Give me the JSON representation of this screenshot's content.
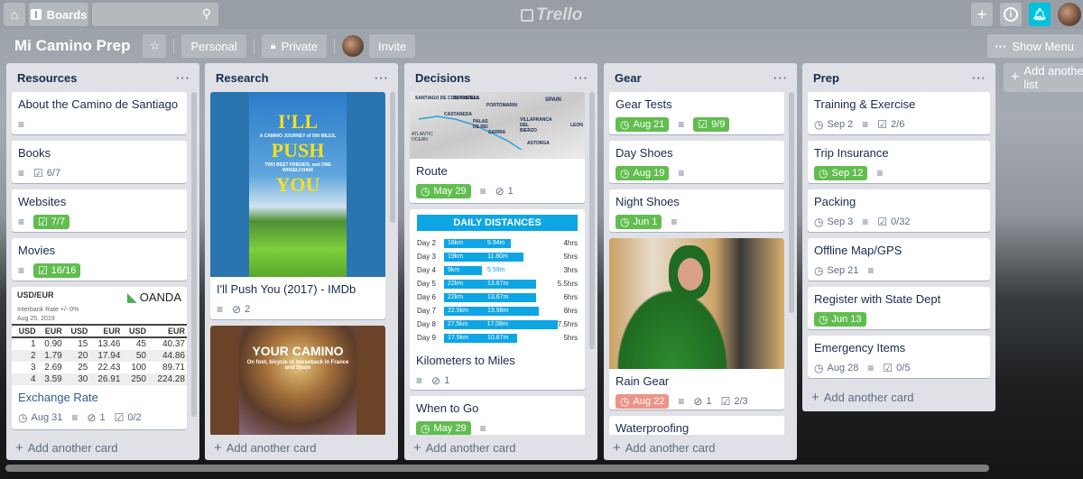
{
  "topbar": {
    "boards_label": "Boards",
    "search_placeholder": "",
    "logo_text": "Trello"
  },
  "board": {
    "title": "Mi Camino Prep",
    "team_label": "Personal",
    "visibility_label": "Private",
    "invite_label": "Invite",
    "show_menu_label": "Show Menu",
    "add_list_label": "Add another list"
  },
  "add_card_label": "Add another card",
  "lists": [
    {
      "title": "Resources",
      "cards": [
        {
          "title": "About the Camino de Santiago",
          "description": true
        },
        {
          "title": "Books",
          "description": true,
          "checklist": "6/7",
          "checklist_complete": false
        },
        {
          "title": "Websites",
          "description": true,
          "checklist": "7/7",
          "checklist_complete": true
        },
        {
          "title": "Movies",
          "description": true,
          "checklist": "16/16",
          "checklist_complete": true
        },
        {
          "title": "Exchange Rate",
          "due": "Aug 31",
          "description": true,
          "attachments": "1",
          "checklist": "0/2",
          "cover": {
            "pair": "USD/EUR",
            "brand": "OANDA",
            "subtitle": "Interbank Rate +/- 0%",
            "date": "Aug 25, 2019",
            "headers": [
              "USD",
              "EUR",
              "USD",
              "EUR",
              "USD",
              "EUR"
            ],
            "rows": [
              [
                "1",
                "0.90",
                "15",
                "13.46",
                "45",
                "40.37"
              ],
              [
                "2",
                "1.79",
                "20",
                "17.94",
                "50",
                "44.86"
              ],
              [
                "3",
                "2.69",
                "25",
                "22.43",
                "100",
                "89.71"
              ],
              [
                "4",
                "3.59",
                "30",
                "26.91",
                "250",
                "224.28"
              ]
            ]
          }
        }
      ]
    },
    {
      "title": "Research",
      "cards": [
        {
          "title": "I'll Push You (2017) - IMDb",
          "description": true,
          "attachments": "2",
          "cover": {
            "line1": "I'LL",
            "line2": "PUSH",
            "line3": "YOU",
            "tagline1": "A CAMINO JOURNEY of 500 MILES,",
            "tagline2": "TWO BEST FRIENDS, and ONE WHEELCHAIR"
          }
        },
        {
          "title": "",
          "cover": {
            "heading": "YOUR CAMINO",
            "sub": "On foot, bicycle or horseback in France and Spain"
          }
        }
      ]
    },
    {
      "title": "Decisions",
      "cards": [
        {
          "title": "Route",
          "due": "May 29",
          "due_status": "complete",
          "description": true,
          "attachments": "1",
          "cover": {
            "labels": [
              "SANTIAGO DE COMPOSTELA",
              "EL AMENAL",
              "CASTANEDA",
              "PALAS DE REI",
              "PORTOMARIN",
              "SARRIA",
              "VILLAFRANCA DEL BIERZO",
              "ASTORGA",
              "LEON",
              "SPAIN",
              "ATLANTIC OCEAN"
            ]
          }
        },
        {
          "title": "Kilometers to Miles",
          "description": true,
          "attachments": "1",
          "cover": {
            "title": "DAILY DISTANCES",
            "rows": [
              {
                "day": "Day 2",
                "km": 16,
                "km_label": "16km",
                "mi": "9.94m",
                "hrs": "4hrs"
              },
              {
                "day": "Day 3",
                "km": 19,
                "km_label": "19km",
                "mi": "11.80m",
                "hrs": "5hrs"
              },
              {
                "day": "Day 4",
                "km": 9,
                "km_label": "9km",
                "mi": "5.59m",
                "hrs": "3hrs"
              },
              {
                "day": "Day 5",
                "km": 22,
                "km_label": "22km",
                "mi": "13.67m",
                "hrs": "5.5hrs"
              },
              {
                "day": "Day 6",
                "km": 22,
                "km_label": "22km",
                "mi": "13.67m",
                "hrs": "6hrs"
              },
              {
                "day": "Day 7",
                "km": 22.5,
                "km_label": "22.5km",
                "mi": "13.98m",
                "hrs": "6hrs"
              },
              {
                "day": "Day 8",
                "km": 27.5,
                "km_label": "27.5km",
                "mi": "17.08m",
                "hrs": "7.5hrs"
              },
              {
                "day": "Day 9",
                "km": 17.5,
                "km_label": "17.5km",
                "mi": "10.87m",
                "hrs": "5hrs"
              }
            ]
          }
        },
        {
          "title": "When to Go",
          "due": "May 29",
          "due_status": "complete",
          "description": true
        }
      ]
    },
    {
      "title": "Gear",
      "cards": [
        {
          "title": "Gear Tests",
          "due": "Aug 21",
          "due_status": "complete",
          "description": true,
          "checklist": "9/9",
          "checklist_complete": true
        },
        {
          "title": "Day Shoes",
          "due": "Aug 19",
          "due_status": "complete",
          "description": true
        },
        {
          "title": "Night Shoes",
          "due": "Jun 1",
          "due_status": "complete",
          "description": true
        },
        {
          "title": "Rain Gear",
          "due": "Aug 22",
          "due_status": "overdue",
          "description": true,
          "attachments": "1",
          "checklist": "2/3",
          "cover": {
            "kind": "photo"
          }
        },
        {
          "title": "Waterproofing"
        }
      ]
    },
    {
      "title": "Prep",
      "cards": [
        {
          "title": "Training & Exercise",
          "due": "Sep 2",
          "description": true,
          "checklist": "2/6"
        },
        {
          "title": "Trip Insurance",
          "due": "Sep 12",
          "due_status": "complete",
          "description": true
        },
        {
          "title": "Packing",
          "due": "Sep 3",
          "description": true,
          "checklist": "0/32"
        },
        {
          "title": "Offline Map/GPS",
          "due": "Sep 21",
          "description": true
        },
        {
          "title": "Register with State Dept",
          "due": "Jun 13",
          "due_status": "complete"
        },
        {
          "title": "Emergency Items",
          "due": "Aug 28",
          "description": true,
          "checklist": "0/5"
        }
      ]
    }
  ],
  "colors": {
    "due_complete": "#61bd4f",
    "due_overdue": "#ec9488",
    "notification": "#00c2e0",
    "list_bg": "#dfe1e6"
  }
}
